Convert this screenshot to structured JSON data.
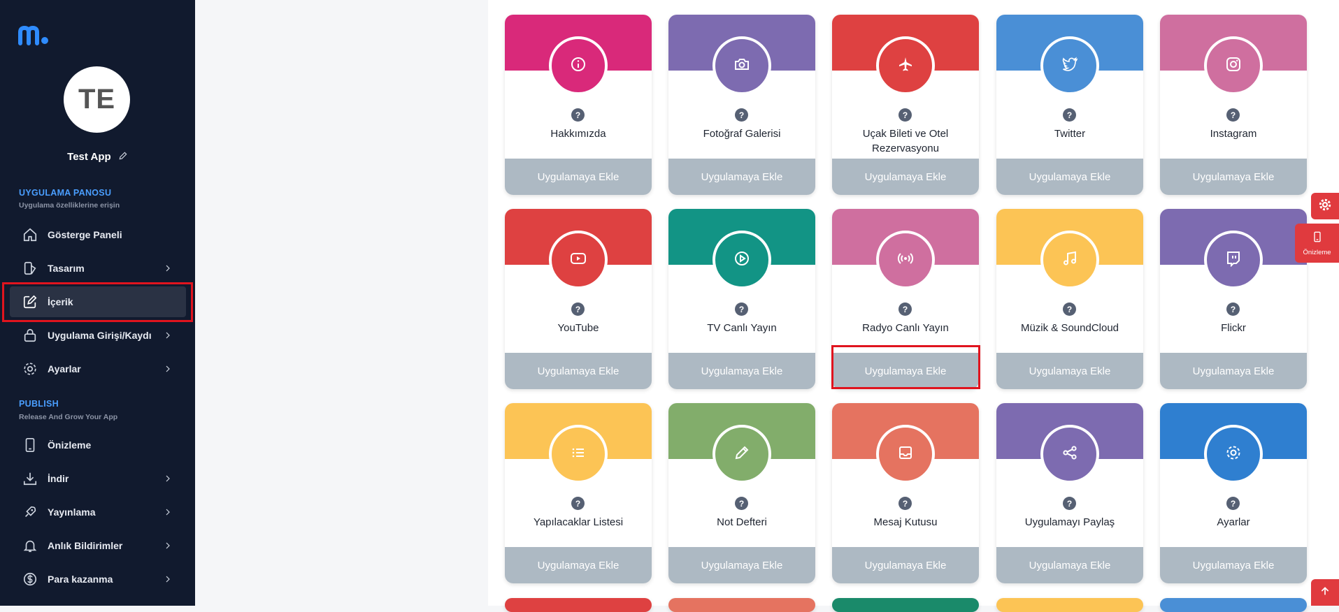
{
  "app": {
    "avatar_initials": "TE",
    "name": "Test App"
  },
  "sections": {
    "dashboard": {
      "title": "UYGULAMA PANOSU",
      "subtitle": "Uygulama özelliklerine erişin"
    },
    "publish": {
      "title": "PUBLISH",
      "subtitle": "Release And Grow Your App"
    }
  },
  "nav": [
    {
      "label": "Gösterge Paneli",
      "icon": "home-icon",
      "chevron": false
    },
    {
      "label": "Tasarım",
      "icon": "design-icon",
      "chevron": true
    },
    {
      "label": "İçerik",
      "icon": "edit-icon",
      "chevron": false,
      "active": true
    },
    {
      "label": "Uygulama Girişi/Kaydı",
      "icon": "lock-icon",
      "chevron": true
    },
    {
      "label": "Ayarlar",
      "icon": "gear-icon",
      "chevron": true
    },
    {
      "label": "Önizleme",
      "icon": "phone-icon",
      "chevron": false
    },
    {
      "label": "İndir",
      "icon": "download-icon",
      "chevron": true
    },
    {
      "label": "Yayınlama",
      "icon": "rocket-icon",
      "chevron": true
    },
    {
      "label": "Anlık Bildirimler",
      "icon": "bell-icon",
      "chevron": true
    },
    {
      "label": "Para kazanma",
      "icon": "dollar-icon",
      "chevron": true
    }
  ],
  "add_button_label": "Uygulamaya Ekle",
  "help_glyph": "?",
  "modules": [
    {
      "title": "Hakkımızda",
      "color": "#d9297a",
      "icon": "info-icon"
    },
    {
      "title": "Fotoğraf Galerisi",
      "color": "#7d6bb0",
      "icon": "camera-icon"
    },
    {
      "title": "Uçak Bileti ve Otel Rezervasyonu",
      "color": "#de4141",
      "icon": "airplane-icon"
    },
    {
      "title": "Twitter",
      "color": "#4a8fd6",
      "icon": "twitter-icon"
    },
    {
      "title": "Instagram",
      "color": "#cf6f9f",
      "icon": "instagram-icon"
    },
    {
      "title": "YouTube",
      "color": "#de4141",
      "icon": "youtube-icon"
    },
    {
      "title": "TV Canlı Yayın",
      "color": "#129485",
      "icon": "play-icon"
    },
    {
      "title": "Radyo Canlı Yayın",
      "color": "#cf6f9f",
      "icon": "radio-icon"
    },
    {
      "title": "Müzik & SoundCloud",
      "color": "#fcc455",
      "icon": "music-icon"
    },
    {
      "title": "Flickr",
      "color": "#7d6bb0",
      "icon": "twitch-icon"
    },
    {
      "title": "Yapılacaklar Listesi",
      "color": "#fcc455",
      "icon": "list-icon"
    },
    {
      "title": "Not Defteri",
      "color": "#82ad6b",
      "icon": "pencil-icon"
    },
    {
      "title": "Mesaj Kutusu",
      "color": "#e57360",
      "icon": "inbox-icon"
    },
    {
      "title": "Uygulamayı Paylaş",
      "color": "#7d6bb0",
      "icon": "share-icon"
    },
    {
      "title": "Ayarlar",
      "color": "#2f7fd0",
      "icon": "settings-icon"
    }
  ],
  "peek_colors": [
    "#de4141",
    "#e57360",
    "#1a8a6a",
    "#fcc455",
    "#4a8fd6"
  ],
  "floating": {
    "settings_icon": "gear-icon",
    "preview_label": "Önizleme",
    "scroll_top_icon": "arrow-up-icon"
  },
  "colors": {
    "sidebar_bg": "#111a2e",
    "accent": "#4a9eff",
    "highlight": "#e0141e",
    "button_bg": "#adb9c3"
  }
}
